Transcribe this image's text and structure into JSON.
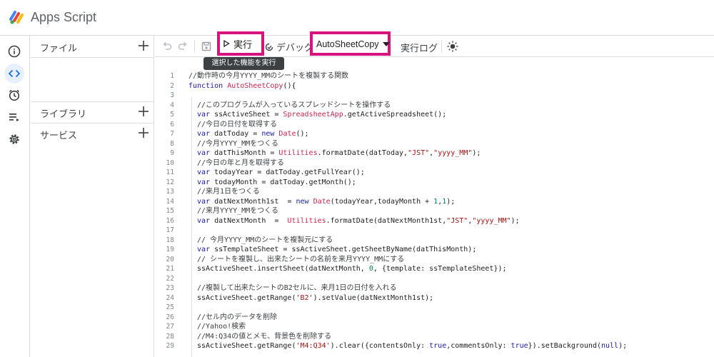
{
  "app": {
    "title": "Apps Script"
  },
  "rail": {
    "items": [
      {
        "icon": "info-icon",
        "active": false
      },
      {
        "icon": "code-icon",
        "active": true
      },
      {
        "icon": "clock-icon",
        "active": false
      },
      {
        "icon": "executions-icon",
        "active": false
      },
      {
        "icon": "gear-icon",
        "active": false
      }
    ]
  },
  "panel": {
    "files_label": "ファイル",
    "libraries_label": "ライブラリ",
    "services_label": "サービス"
  },
  "toolbar": {
    "run_label": "実行",
    "debug_label": "デバッグ",
    "function_select": "AutoSheetCopy",
    "log_label": "実行ログ",
    "tooltip": "選択した機能を実行"
  },
  "colors": {
    "highlight": "#d8137f",
    "keyword": "#1a1aa6",
    "function": "#c7254e",
    "string": "#a31515",
    "number": "#098658",
    "active_rail": "#e8f0fe"
  },
  "editor": {
    "lines": [
      {
        "n": "1",
        "indent": 0,
        "tokens": [
          [
            "cm",
            "//動作時の今月YYYY_MMのシートを複製する関数"
          ]
        ]
      },
      {
        "n": "2",
        "indent": 0,
        "tokens": [
          [
            "kw",
            "function "
          ],
          [
            "fn",
            "AutoSheetCopy"
          ],
          [
            "",
            "(){"
          ]
        ]
      },
      {
        "n": "3",
        "indent": 0,
        "tokens": []
      },
      {
        "n": "4",
        "indent": 1,
        "tokens": [
          [
            "cm",
            "//このプログラムが入っているスプレッドシートを操作する"
          ]
        ]
      },
      {
        "n": "5",
        "indent": 1,
        "tokens": [
          [
            "kw",
            "var "
          ],
          [
            "",
            "ssActiveSheet = "
          ],
          [
            "cls",
            "SpreadsheetApp"
          ],
          [
            "",
            ".getActiveSpreadsheet();"
          ]
        ]
      },
      {
        "n": "6",
        "indent": 1,
        "tokens": [
          [
            "cm",
            "//今日の日付を取得する"
          ]
        ]
      },
      {
        "n": "7",
        "indent": 1,
        "tokens": [
          [
            "kw",
            "var "
          ],
          [
            "",
            "datToday = "
          ],
          [
            "kw",
            "new "
          ],
          [
            "cls",
            "Date"
          ],
          [
            "",
            "();"
          ]
        ]
      },
      {
        "n": "8",
        "indent": 1,
        "tokens": [
          [
            "cm",
            "//今月YYYY_MMをつくる"
          ]
        ]
      },
      {
        "n": "9",
        "indent": 1,
        "tokens": [
          [
            "kw",
            "var "
          ],
          [
            "",
            "datThisMonth = "
          ],
          [
            "cls",
            "Utilities"
          ],
          [
            "",
            ".formatDate(datToday,"
          ],
          [
            "str",
            "\"JST\""
          ],
          [
            "",
            ","
          ],
          [
            "str",
            "\"yyyy_MM\""
          ],
          [
            "",
            ");"
          ]
        ]
      },
      {
        "n": "10",
        "indent": 1,
        "tokens": [
          [
            "cm",
            "//今日の年と月を取得する"
          ]
        ]
      },
      {
        "n": "11",
        "indent": 1,
        "tokens": [
          [
            "kw",
            "var "
          ],
          [
            "",
            "todayYear = datToday.getFullYear();"
          ]
        ]
      },
      {
        "n": "12",
        "indent": 1,
        "tokens": [
          [
            "kw",
            "var "
          ],
          [
            "",
            "todayMonth = datToday.getMonth();"
          ]
        ]
      },
      {
        "n": "13",
        "indent": 1,
        "tokens": [
          [
            "cm",
            "//来月1日をつくる"
          ]
        ]
      },
      {
        "n": "14",
        "indent": 1,
        "tokens": [
          [
            "kw",
            "var "
          ],
          [
            "",
            "datNextMonth1st  = "
          ],
          [
            "kw",
            "new "
          ],
          [
            "cls",
            "Date"
          ],
          [
            "",
            "(todayYear,todayMonth + "
          ],
          [
            "num",
            "1"
          ],
          [
            "",
            ","
          ],
          [
            "num",
            "1"
          ],
          [
            "",
            ");"
          ]
        ]
      },
      {
        "n": "15",
        "indent": 1,
        "tokens": [
          [
            "cm",
            "//来月YYYY_MMをつくる"
          ]
        ]
      },
      {
        "n": "16",
        "indent": 1,
        "tokens": [
          [
            "kw",
            "var "
          ],
          [
            "",
            "datNextMonth  =  "
          ],
          [
            "cls",
            "Utilities"
          ],
          [
            "",
            ".formatDate(datNextMonth1st,"
          ],
          [
            "str",
            "\"JST\""
          ],
          [
            "",
            ","
          ],
          [
            "str",
            "\"yyyy_MM\""
          ],
          [
            "",
            ");"
          ]
        ]
      },
      {
        "n": "17",
        "indent": 0,
        "tokens": []
      },
      {
        "n": "18",
        "indent": 1,
        "tokens": [
          [
            "cm",
            "// 今月YYYY_MMのシートを複製元にする"
          ]
        ]
      },
      {
        "n": "19",
        "indent": 1,
        "tokens": [
          [
            "kw",
            "var "
          ],
          [
            "",
            "ssTemplateSheet = ssActiveSheet.getSheetByName(datThisMonth);"
          ]
        ]
      },
      {
        "n": "20",
        "indent": 1,
        "tokens": [
          [
            "cm",
            "// シートを複製し、出来たシートの名前を来月YYYY_MMにする"
          ]
        ]
      },
      {
        "n": "21",
        "indent": 1,
        "tokens": [
          [
            "",
            "ssActiveSheet.insertSheet(datNextMonth, "
          ],
          [
            "num",
            "0"
          ],
          [
            "",
            ", {template: ssTemplateSheet});"
          ]
        ]
      },
      {
        "n": "22",
        "indent": 0,
        "tokens": []
      },
      {
        "n": "23",
        "indent": 1,
        "tokens": [
          [
            "cm",
            "//複製して出来たシートのB2セルに、来月1日の日付を入れる"
          ]
        ]
      },
      {
        "n": "24",
        "indent": 1,
        "tokens": [
          [
            "",
            "ssActiveSheet.getRange("
          ],
          [
            "str",
            "'B2'"
          ],
          [
            "",
            ").setValue(datNextMonth1st);"
          ]
        ]
      },
      {
        "n": "25",
        "indent": 0,
        "tokens": []
      },
      {
        "n": "26",
        "indent": 1,
        "tokens": [
          [
            "cm",
            "//セル内のデータを削除"
          ]
        ]
      },
      {
        "n": "27",
        "indent": 1,
        "tokens": [
          [
            "cm",
            "//Yahoo!検索"
          ]
        ]
      },
      {
        "n": "28",
        "indent": 1,
        "tokens": [
          [
            "cm",
            "//M4:Q34の値とメモ、背景色を削除する"
          ]
        ]
      },
      {
        "n": "29",
        "indent": 1,
        "tokens": [
          [
            "",
            "ssActiveSheet.getRange("
          ],
          [
            "str",
            "'M4:Q34'"
          ],
          [
            "",
            ").clear({contentsOnly: "
          ],
          [
            "kw",
            "true"
          ],
          [
            "",
            ",commentsOnly: "
          ],
          [
            "kw",
            "true"
          ],
          [
            "",
            "}).setBackground("
          ],
          [
            "kw",
            "null"
          ],
          [
            "",
            ");"
          ]
        ]
      }
    ]
  }
}
